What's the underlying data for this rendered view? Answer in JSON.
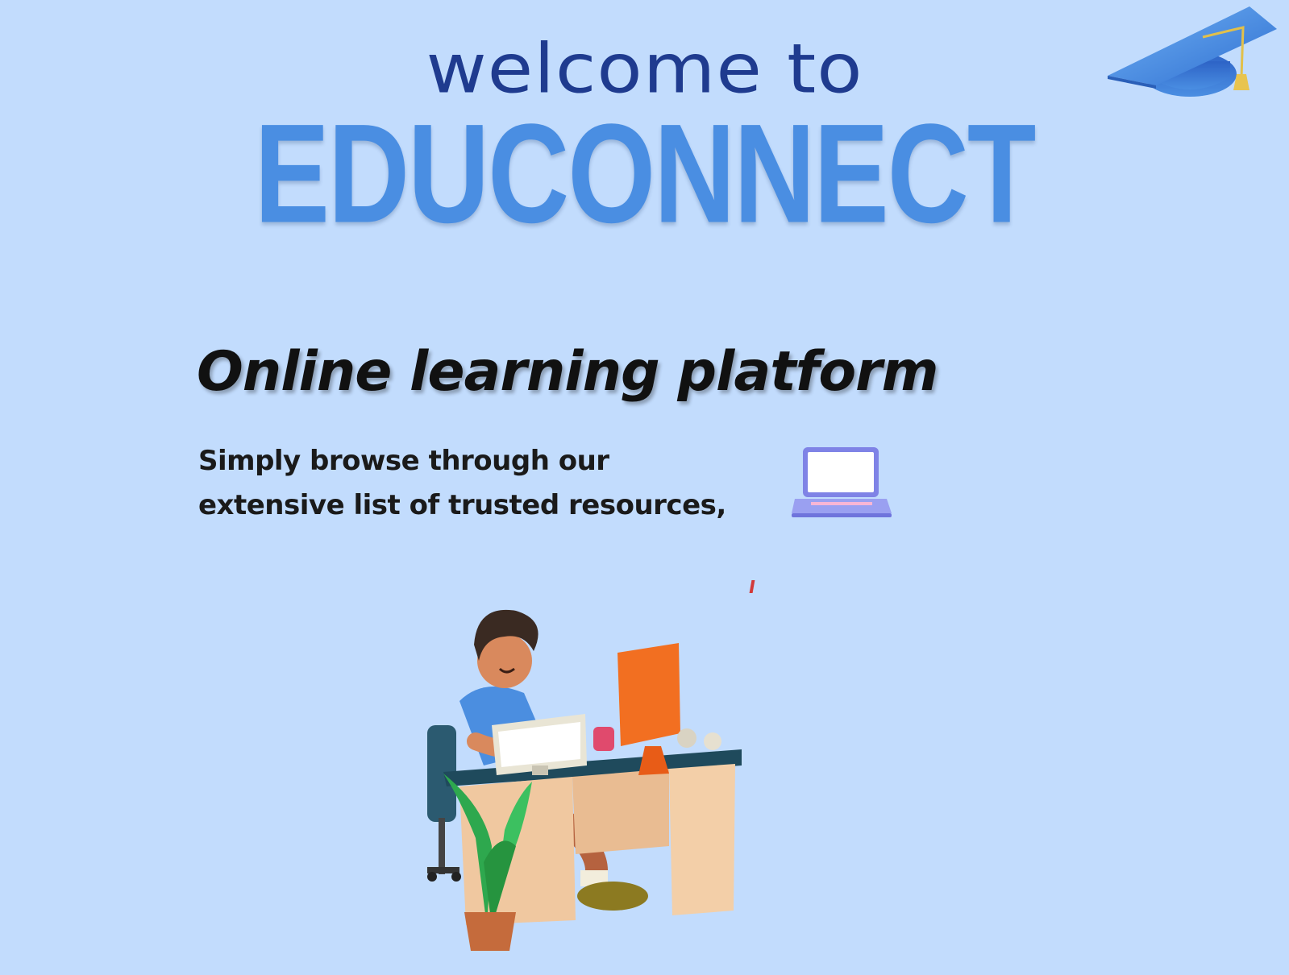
{
  "hero": {
    "welcome": "welcome to",
    "brand": "EDUCONNECT"
  },
  "section": {
    "tagline": "Online learning platform",
    "description_lines": [
      "Simply browse through our",
      "extensive list of trusted resources,"
    ]
  },
  "icons": {
    "cap": "graduation-cap-icon",
    "laptop": "laptop-icon"
  },
  "colors": {
    "background": "#c2dcfd",
    "brand": "#4a8ee2",
    "welcome": "#1f3b8f",
    "text": "#111111"
  }
}
